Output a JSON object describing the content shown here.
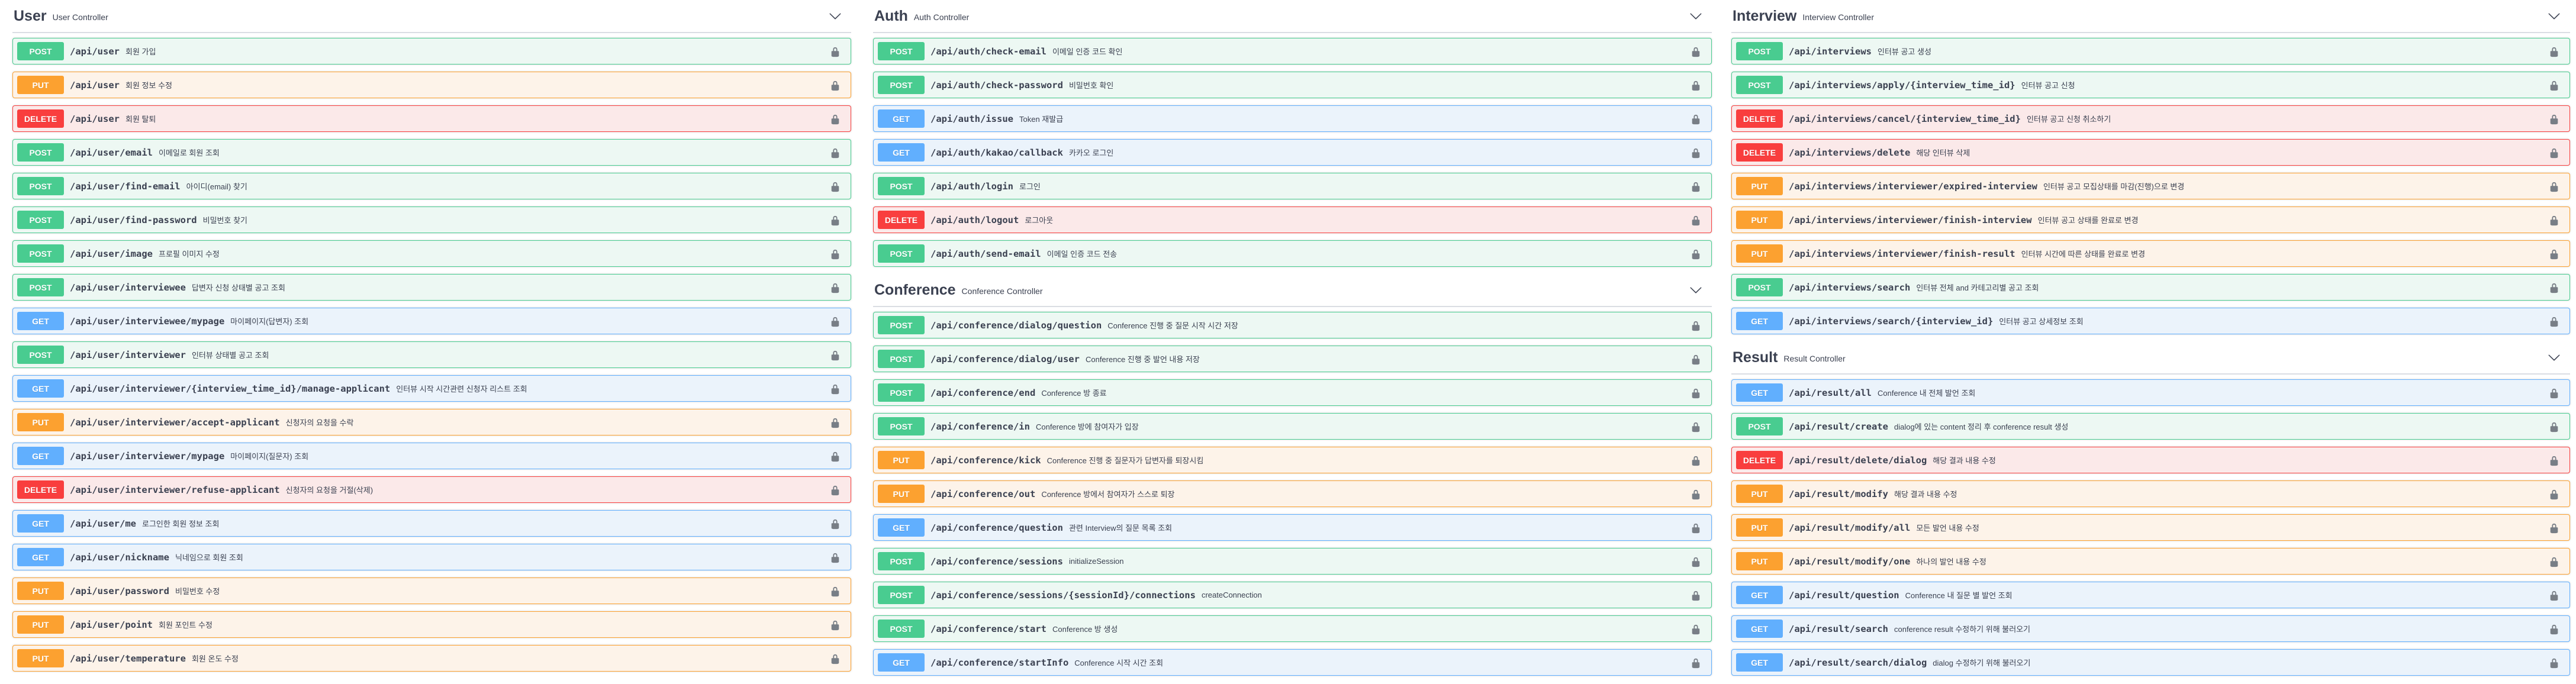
{
  "colors": {
    "post": "#49cc90",
    "put": "#fca130",
    "delete": "#f93e3e",
    "get": "#61affe",
    "post_bg": "#edf8f3",
    "put_bg": "#fdf3e9",
    "delete_bg": "#fbe9e9",
    "get_bg": "#ebf3fb"
  },
  "icons": {
    "collapse": "chevron-down-icon",
    "authorization": "lock-icon"
  },
  "columns": [
    {
      "sections": [
        {
          "name": "User",
          "description": "User Controller",
          "operations": [
            {
              "method": "POST",
              "path": "/api/user",
              "summary": "회원 가입"
            },
            {
              "method": "PUT",
              "path": "/api/user",
              "summary": "회원 정보 수정"
            },
            {
              "method": "DELETE",
              "path": "/api/user",
              "summary": "회원 탈퇴"
            },
            {
              "method": "POST",
              "path": "/api/user/email",
              "summary": "이메일로 회원 조회"
            },
            {
              "method": "POST",
              "path": "/api/user/find-email",
              "summary": "아이디(email) 찾기"
            },
            {
              "method": "POST",
              "path": "/api/user/find-password",
              "summary": "비밀번호 찾기"
            },
            {
              "method": "POST",
              "path": "/api/user/image",
              "summary": "프로필 이미지 수정"
            },
            {
              "method": "POST",
              "path": "/api/user/interviewee",
              "summary": "답변자 신청 상태별 공고 조회"
            },
            {
              "method": "GET",
              "path": "/api/user/interviewee/mypage",
              "summary": "마이페이지(답변자) 조회"
            },
            {
              "method": "POST",
              "path": "/api/user/interviewer",
              "summary": "인터뷰 상태별 공고 조회"
            },
            {
              "method": "GET",
              "path": "/api/user/interviewer/{interview_time_id}/manage-applicant",
              "summary": "인터뷰 시작 시간관련 신청자 리스트 조회"
            },
            {
              "method": "PUT",
              "path": "/api/user/interviewer/accept-applicant",
              "summary": "신청자의 요청을 수락"
            },
            {
              "method": "GET",
              "path": "/api/user/interviewer/mypage",
              "summary": "마이페이지(질문자) 조회"
            },
            {
              "method": "DELETE",
              "path": "/api/user/interviewer/refuse-applicant",
              "summary": "신청자의 요청을 거절(삭제)"
            },
            {
              "method": "GET",
              "path": "/api/user/me",
              "summary": "로그인한 회원 정보 조회"
            },
            {
              "method": "GET",
              "path": "/api/user/nickname",
              "summary": "닉네임으로 회원 조회"
            },
            {
              "method": "PUT",
              "path": "/api/user/password",
              "summary": "비밀번호 수정"
            },
            {
              "method": "PUT",
              "path": "/api/user/point",
              "summary": "회원 포인트 수정"
            },
            {
              "method": "PUT",
              "path": "/api/user/temperature",
              "summary": "회원 온도 수정"
            }
          ]
        }
      ]
    },
    {
      "sections": [
        {
          "name": "Auth",
          "description": "Auth Controller",
          "operations": [
            {
              "method": "POST",
              "path": "/api/auth/check-email",
              "summary": "이메일 인증 코드 확인"
            },
            {
              "method": "POST",
              "path": "/api/auth/check-password",
              "summary": "비밀번호 확인"
            },
            {
              "method": "GET",
              "path": "/api/auth/issue",
              "summary": "Token 재발급"
            },
            {
              "method": "GET",
              "path": "/api/auth/kakao/callback",
              "summary": "카카오 로그인"
            },
            {
              "method": "POST",
              "path": "/api/auth/login",
              "summary": "로그인"
            },
            {
              "method": "DELETE",
              "path": "/api/auth/logout",
              "summary": "로그아웃"
            },
            {
              "method": "POST",
              "path": "/api/auth/send-email",
              "summary": "이메일 인증 코드 전송"
            }
          ]
        },
        {
          "name": "Conference",
          "description": "Conference Controller",
          "operations": [
            {
              "method": "POST",
              "path": "/api/conference/dialog/question",
              "summary": "Conference 진행 중 질문 시작 시간 저장"
            },
            {
              "method": "POST",
              "path": "/api/conference/dialog/user",
              "summary": "Conference 진행 중 발언 내용 저장"
            },
            {
              "method": "POST",
              "path": "/api/conference/end",
              "summary": "Conference 방 종료"
            },
            {
              "method": "POST",
              "path": "/api/conference/in",
              "summary": "Conference 방에 참여자가 입장"
            },
            {
              "method": "PUT",
              "path": "/api/conference/kick",
              "summary": "Conference 진행 중 질문자가 답변자를 퇴장시킴"
            },
            {
              "method": "PUT",
              "path": "/api/conference/out",
              "summary": "Conference 방에서 참여자가 스스로 퇴장"
            },
            {
              "method": "GET",
              "path": "/api/conference/question",
              "summary": "관련 Interview의 질문 목록 조회"
            },
            {
              "method": "POST",
              "path": "/api/conference/sessions",
              "summary": "initializeSession"
            },
            {
              "method": "POST",
              "path": "/api/conference/sessions/{sessionId}/connections",
              "summary": "createConnection"
            },
            {
              "method": "POST",
              "path": "/api/conference/start",
              "summary": "Conference 방 생성"
            },
            {
              "method": "GET",
              "path": "/api/conference/startInfo",
              "summary": "Conference 시작 시간 조회"
            }
          ]
        }
      ]
    },
    {
      "sections": [
        {
          "name": "Interview",
          "description": "Interview Controller",
          "operations": [
            {
              "method": "POST",
              "path": "/api/interviews",
              "summary": "인터뷰 공고 생성"
            },
            {
              "method": "POST",
              "path": "/api/interviews/apply/{interview_time_id}",
              "summary": "인터뷰 공고 신청"
            },
            {
              "method": "DELETE",
              "path": "/api/interviews/cancel/{interview_time_id}",
              "summary": "인터뷰 공고 신청 취소하기"
            },
            {
              "method": "DELETE",
              "path": "/api/interviews/delete",
              "summary": "해당 인터뷰 삭제"
            },
            {
              "method": "PUT",
              "path": "/api/interviews/interviewer/expired-interview",
              "summary": "인터뷰 공고 모집상태를 마감(진행)으로 변경"
            },
            {
              "method": "PUT",
              "path": "/api/interviews/interviewer/finish-interview",
              "summary": "인터뷰 공고 상태를 완료로 변경"
            },
            {
              "method": "PUT",
              "path": "/api/interviews/interviewer/finish-result",
              "summary": "인터뷰 시간에 따른 상태를 완료로 변경"
            },
            {
              "method": "POST",
              "path": "/api/interviews/search",
              "summary": "인터뷰 전체 and 카테고리별 공고 조회"
            },
            {
              "method": "GET",
              "path": "/api/interviews/search/{interview_id}",
              "summary": "인터뷰 공고 상세정보 조회"
            }
          ]
        },
        {
          "name": "Result",
          "description": "Result Controller",
          "operations": [
            {
              "method": "GET",
              "path": "/api/result/all",
              "summary": "Conference 내 전체 발언 조회"
            },
            {
              "method": "POST",
              "path": "/api/result/create",
              "summary": "dialog에 있는 content 정리 후 conference result 생성"
            },
            {
              "method": "DELETE",
              "path": "/api/result/delete/dialog",
              "summary": "해당 결과 내용 수정"
            },
            {
              "method": "PUT",
              "path": "/api/result/modify",
              "summary": "해당 결과 내용 수정"
            },
            {
              "method": "PUT",
              "path": "/api/result/modify/all",
              "summary": "모든 발언 내용 수정"
            },
            {
              "method": "PUT",
              "path": "/api/result/modify/one",
              "summary": "하나의 발언 내용 수정"
            },
            {
              "method": "GET",
              "path": "/api/result/question",
              "summary": "Conference 내 질문 별 발언 조회"
            },
            {
              "method": "GET",
              "path": "/api/result/search",
              "summary": "conference result 수정하기 위해 불러오기"
            },
            {
              "method": "GET",
              "path": "/api/result/search/dialog",
              "summary": "dialog 수정하기 위해 불러오기"
            }
          ]
        }
      ]
    }
  ]
}
